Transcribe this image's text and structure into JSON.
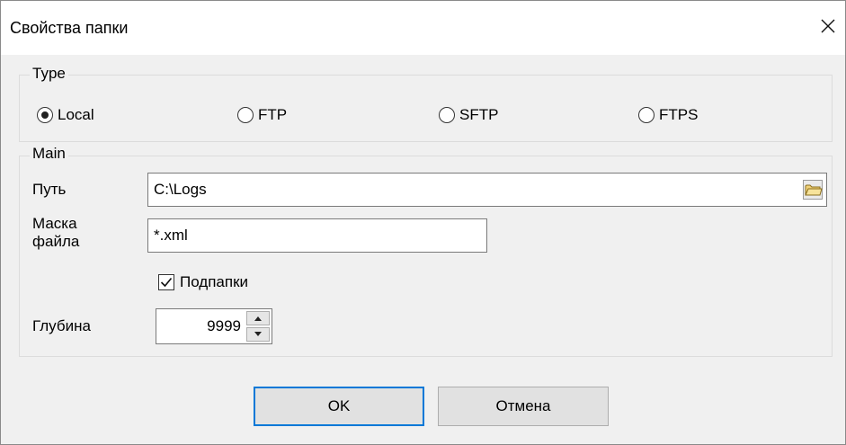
{
  "window": {
    "title": "Свойства папки"
  },
  "type_group": {
    "legend": "Type",
    "options": [
      {
        "label": "Local",
        "selected": true
      },
      {
        "label": "FTP",
        "selected": false
      },
      {
        "label": "SFTP",
        "selected": false
      },
      {
        "label": "FTPS",
        "selected": false
      }
    ]
  },
  "main_group": {
    "legend": "Main",
    "path_label": "Путь",
    "path_value": "C:\\Logs",
    "mask_label_line1": "Маска",
    "mask_label_line2": "файла",
    "mask_value": "*.xml",
    "subfolders_label": "Подпапки",
    "subfolders_checked": true,
    "depth_label": "Глубина",
    "depth_value": "9999"
  },
  "buttons": {
    "ok": "OK",
    "cancel": "Отмена"
  }
}
